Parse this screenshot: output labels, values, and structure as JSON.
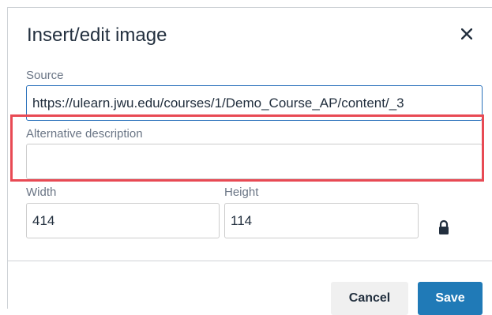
{
  "dialog": {
    "title": "Insert/edit image",
    "close_icon": "close-icon"
  },
  "source": {
    "label": "Source",
    "value": "https://ulearn.jwu.edu/courses/1/Demo_Course_AP/content/_3"
  },
  "alt": {
    "label": "Alternative description",
    "value": ""
  },
  "dimensions": {
    "width_label": "Width",
    "width_value": "414",
    "height_label": "Height",
    "height_value": "114",
    "lock_icon": "lock-icon"
  },
  "footer": {
    "cancel_label": "Cancel",
    "save_label": "Save"
  },
  "colors": {
    "accent": "#207ab7",
    "highlight": "#e84a54",
    "text": "#222f3e"
  }
}
